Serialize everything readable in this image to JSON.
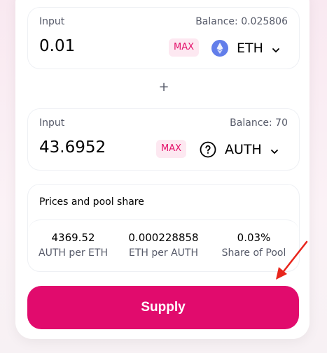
{
  "panel_a": {
    "label": "Input",
    "balance": "Balance: 0.025806",
    "amount": "0.01",
    "max_label": "MAX",
    "token": "ETH",
    "token_icon": "ethereum-icon"
  },
  "separator": "+",
  "panel_b": {
    "label": "Input",
    "balance": "Balance: 70",
    "amount": "43.6952",
    "max_label": "MAX",
    "token": "AUTH",
    "token_icon": "unknown-token-icon"
  },
  "prices": {
    "title": "Prices and pool share",
    "stats": [
      {
        "value": "4369.52",
        "label": "AUTH per ETH"
      },
      {
        "value": "0.000228858",
        "label": "ETH per AUTH"
      },
      {
        "value": "0.03%",
        "label": "Share of Pool"
      }
    ]
  },
  "supply_label": "Supply",
  "colors": {
    "accent": "#e10b6d",
    "max_bg": "#fde8f1",
    "annotation_arrow": "#e8251c"
  }
}
